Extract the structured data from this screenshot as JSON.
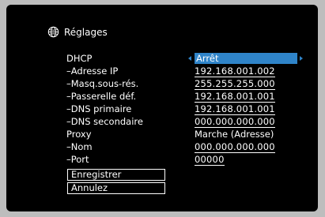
{
  "header": {
    "title": "Réglages",
    "icon": "globe-icon"
  },
  "rows": [
    {
      "label": "DHCP",
      "value": "Arrêt"
    },
    {
      "label": "–Adresse IP",
      "value": "192.168.001.002"
    },
    {
      "label": "–Masq.sous-rés.",
      "value": "255.255.255.000"
    },
    {
      "label": "–Passerelle déf.",
      "value": "192.168.001.001"
    },
    {
      "label": "–DNS primaire",
      "value": "192.168.001.001"
    },
    {
      "label": "–DNS secondaire",
      "value": "000.000.000.000"
    },
    {
      "label": "Proxy",
      "value": "Marche (Adresse)"
    },
    {
      "label": "–Nom",
      "value": "000.000.000.000"
    },
    {
      "label": "–Port",
      "value": "00000"
    }
  ],
  "buttons": {
    "save_label": "Enregistrer",
    "cancel_label": "Annulez"
  },
  "colors": {
    "accent": "#2f84c9",
    "background": "#000000",
    "text": "#ffffff"
  }
}
